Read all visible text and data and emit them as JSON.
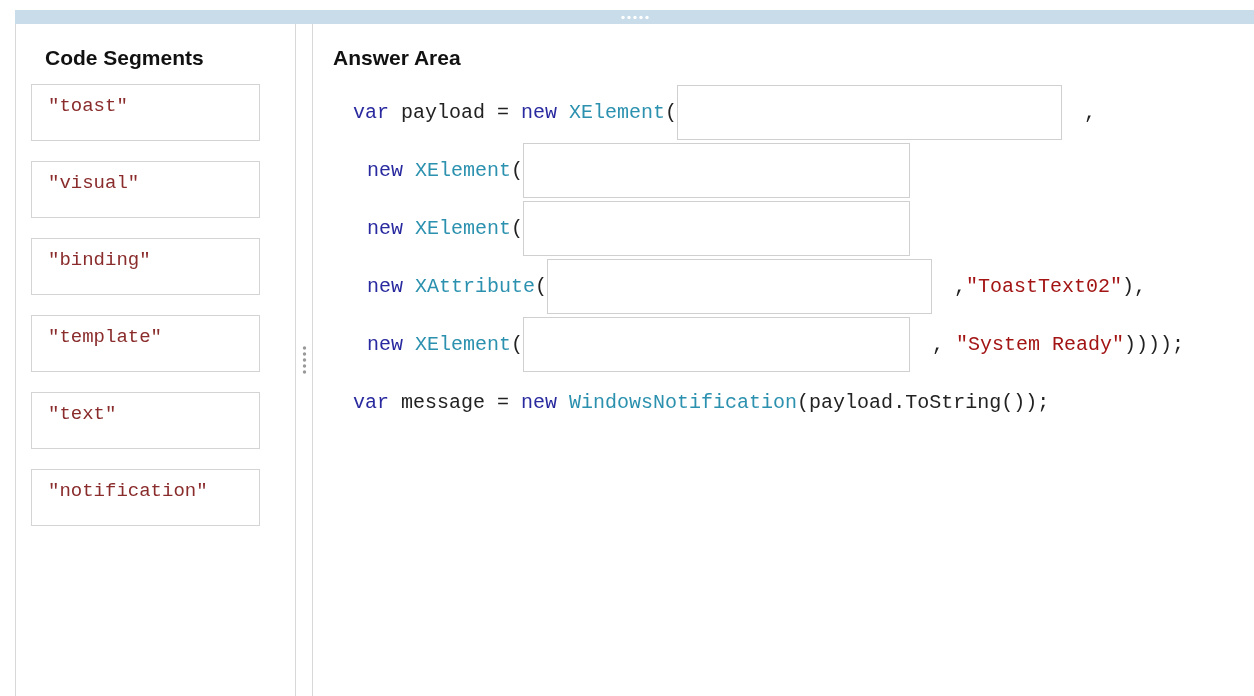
{
  "segments_panel": {
    "title": "Code Segments",
    "items": [
      {
        "text": "\"toast\""
      },
      {
        "text": "\"visual\""
      },
      {
        "text": "\"binding\""
      },
      {
        "text": "\"template\""
      },
      {
        "text": "\"text\""
      },
      {
        "text": "\"notification\""
      }
    ]
  },
  "answer_area": {
    "title": "Answer Area",
    "lines": [
      {
        "segments": [
          {
            "kind": "code",
            "tokens": [
              {
                "kind": "keyword",
                "text": "var"
              },
              {
                "kind": "plain",
                "text": " payload = "
              },
              {
                "kind": "keyword",
                "text": "new"
              },
              {
                "kind": "type",
                "text": " XElement"
              },
              {
                "kind": "plain",
                "text": "("
              }
            ]
          },
          {
            "kind": "slot"
          },
          {
            "kind": "code",
            "tokens": [
              {
                "kind": "plain",
                "text": ","
              }
            ]
          }
        ]
      },
      {
        "segments": [
          {
            "kind": "code",
            "tokens": [
              {
                "kind": "keyword",
                "text": "new"
              },
              {
                "kind": "type",
                "text": " XElement"
              },
              {
                "kind": "plain",
                "text": "("
              }
            ]
          },
          {
            "kind": "slot"
          }
        ]
      },
      {
        "segments": [
          {
            "kind": "code",
            "tokens": [
              {
                "kind": "keyword",
                "text": "new"
              },
              {
                "kind": "type",
                "text": " XElement"
              },
              {
                "kind": "plain",
                "text": "("
              }
            ]
          },
          {
            "kind": "slot"
          }
        ]
      },
      {
        "segments": [
          {
            "kind": "code",
            "tokens": [
              {
                "kind": "keyword",
                "text": "new"
              },
              {
                "kind": "type",
                "text": " XAttribute"
              },
              {
                "kind": "plain",
                "text": "("
              }
            ]
          },
          {
            "kind": "slot"
          },
          {
            "kind": "code",
            "tokens": [
              {
                "kind": "plain",
                "text": ","
              },
              {
                "kind": "string",
                "text": "\"ToastText02\""
              },
              {
                "kind": "plain",
                "text": "),"
              }
            ]
          }
        ]
      },
      {
        "segments": [
          {
            "kind": "code",
            "tokens": [
              {
                "kind": "keyword",
                "text": "new"
              },
              {
                "kind": "type",
                "text": " XElement"
              },
              {
                "kind": "plain",
                "text": "("
              }
            ]
          },
          {
            "kind": "slot"
          },
          {
            "kind": "code",
            "tokens": [
              {
                "kind": "plain",
                "text": ", "
              },
              {
                "kind": "string",
                "text": "\"System Ready\""
              },
              {
                "kind": "plain",
                "text": "))));"
              }
            ]
          }
        ]
      },
      {
        "segments": [
          {
            "kind": "code",
            "tokens": [
              {
                "kind": "keyword",
                "text": "var"
              },
              {
                "kind": "plain",
                "text": " message = "
              },
              {
                "kind": "keyword",
                "text": "new"
              },
              {
                "kind": "type",
                "text": " WindowsNotification"
              },
              {
                "kind": "plain",
                "text": "(payload.ToString());"
              }
            ]
          }
        ]
      }
    ]
  }
}
